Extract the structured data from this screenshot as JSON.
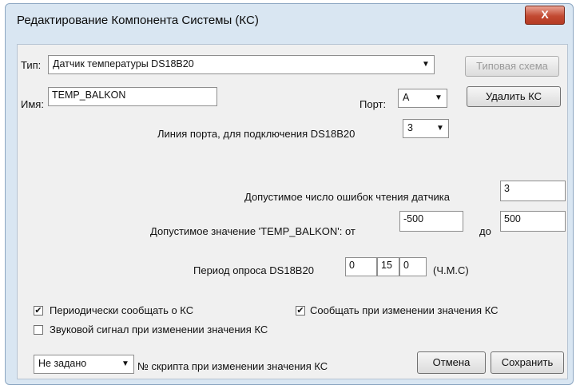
{
  "window": {
    "title": "Редактирование Компонента Системы (КС)",
    "close_glyph": "X"
  },
  "type": {
    "label": "Тип:",
    "value": "Датчик температуры DS18B20"
  },
  "buttons": {
    "typical_scheme": "Типовая схема",
    "delete": "Удалить КС",
    "cancel": "Отмена",
    "save": "Сохранить"
  },
  "name": {
    "label": "Имя:",
    "value": "TEMP_BALKON"
  },
  "port": {
    "label": "Порт:",
    "value": "A"
  },
  "port_line": {
    "label": "Линия порта, для подключения DS18B20",
    "value": "3"
  },
  "errors": {
    "label": "Допустимое число ошибок чтения датчика",
    "value": "3"
  },
  "range": {
    "label": "Допустимое значение 'TEMP_BALKON':  от",
    "from": "-500",
    "to_label": "до",
    "to": "500"
  },
  "period": {
    "label": "Период опроса DS18B20",
    "h": "0",
    "m": "15",
    "s": "0",
    "units": "(Ч.М.С)"
  },
  "checkboxes": {
    "periodic": {
      "label": "Периодически сообщать о КС",
      "checked": true
    },
    "on_change": {
      "label": "Сообщать при изменении значения КС",
      "checked": true
    },
    "sound": {
      "label": "Звуковой сигнал при изменении значения КС",
      "checked": false
    }
  },
  "script": {
    "value": "Не задано",
    "label": "№ скрипта при изменении значения КС"
  }
}
